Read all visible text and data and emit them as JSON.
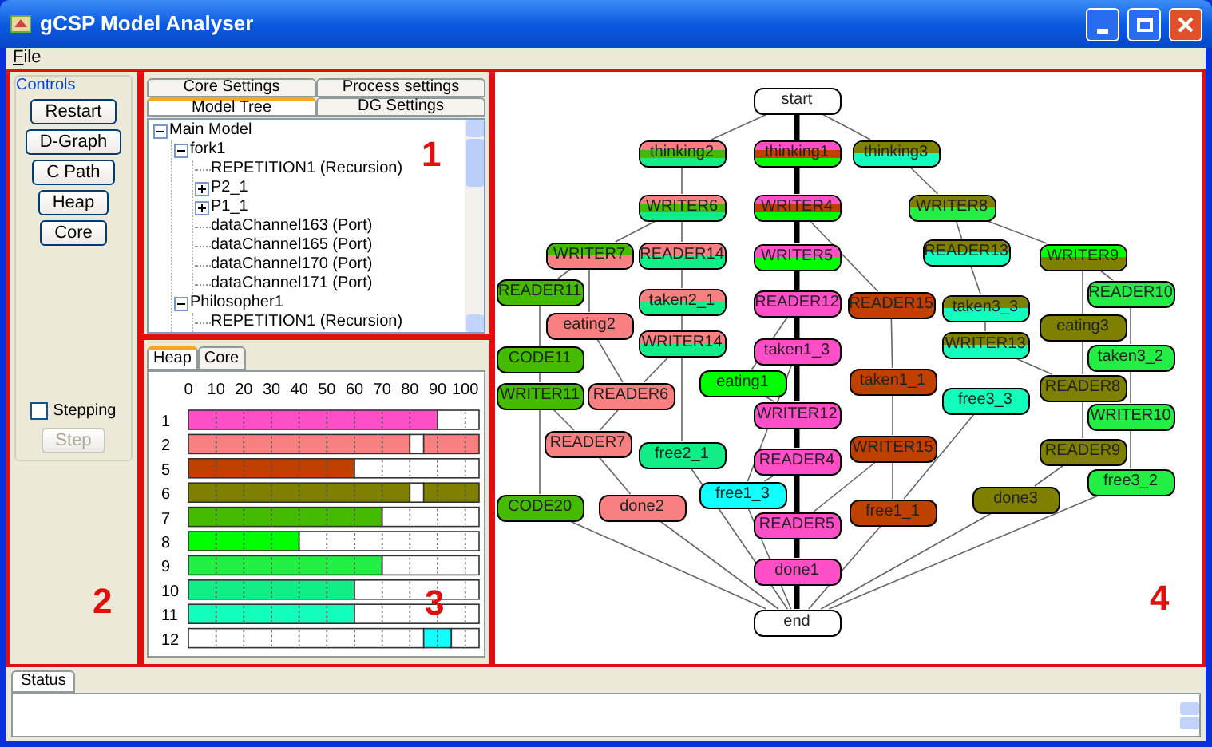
{
  "window": {
    "title": "gCSP Model Analyser"
  },
  "menu": [
    "File"
  ],
  "controls": {
    "title": "Controls",
    "buttons": [
      {
        "label": "Restart"
      },
      {
        "label": "D-Graph"
      },
      {
        "label": "C Path"
      },
      {
        "label": "Heap"
      },
      {
        "label": "Core"
      }
    ],
    "stepping": {
      "label": "Stepping",
      "checked": false
    },
    "step_button": {
      "label": "Step",
      "disabled": true
    }
  },
  "settings_panel": {
    "tab_rows": [
      [
        {
          "label": "Core Settings",
          "selected": false
        },
        {
          "label": "Process settings",
          "selected": false
        }
      ],
      [
        {
          "label": "Model Tree",
          "selected": true
        },
        {
          "label": "DG Settings",
          "selected": false
        }
      ]
    ],
    "tree": [
      {
        "label": "Main Model",
        "expanded": true,
        "children": [
          {
            "label": "fork1",
            "expanded": true,
            "children": [
              {
                "label": "REPETITION1 (Recursion)"
              },
              {
                "label": "P2_1",
                "expanded": false
              },
              {
                "label": "P1_1",
                "expanded": false
              },
              {
                "label": "dataChannel163 (Port)"
              },
              {
                "label": "dataChannel165 (Port)"
              },
              {
                "label": "dataChannel170 (Port)"
              },
              {
                "label": "dataChannel171 (Port)"
              }
            ]
          },
          {
            "label": "Philosopher1",
            "expanded": true,
            "children": [
              {
                "label": "REPETITION1 (Recursion)"
              }
            ]
          }
        ]
      }
    ]
  },
  "usage_panel": {
    "tabs": [
      {
        "label": "Heap",
        "selected": true
      },
      {
        "label": "Core",
        "selected": false
      }
    ],
    "chart_data": {
      "type": "bar",
      "orientation": "horizontal",
      "stacked": true,
      "categories": [
        "1",
        "2",
        "5",
        "6",
        "7",
        "8",
        "9",
        "10",
        "11",
        "12"
      ],
      "xlim": [
        0,
        105
      ],
      "xticks": [
        0,
        10,
        20,
        30,
        40,
        50,
        60,
        70,
        80,
        90,
        100
      ],
      "series": [
        {
          "colors": [
            "#ff4fc8",
            "#f88080",
            "#c04000",
            "#808000",
            "#44bb00",
            "#00ff00",
            "#22ee44",
            "#11ee88",
            "#11ffbb",
            null
          ],
          "values": [
            90,
            80,
            60,
            80,
            70,
            40,
            70,
            60,
            60,
            null
          ]
        },
        {
          "color": "#ffffff",
          "values": [
            null,
            5,
            null,
            5,
            null,
            null,
            null,
            null,
            null,
            85
          ]
        },
        {
          "colors": [
            null,
            "#f88080",
            null,
            "#808000",
            null,
            null,
            null,
            null,
            null,
            "#11ffff"
          ],
          "values": [
            null,
            20,
            null,
            20,
            null,
            null,
            null,
            null,
            null,
            10
          ]
        },
        {
          "color": "#ffffff",
          "values": [
            15,
            null,
            45,
            null,
            35,
            65,
            35,
            45,
            45,
            10
          ]
        }
      ]
    }
  },
  "graph": {
    "nodes": [
      {
        "label": "start",
        "bands": [
          {
            "color": "#ffffff"
          }
        ]
      },
      {
        "label": "thinking2",
        "bands": [
          {
            "color": "#f88080"
          },
          {
            "color": "#44bb00"
          },
          {
            "color": "#11ee88"
          }
        ]
      },
      {
        "label": "thinking1",
        "bands": [
          {
            "color": "#ff4fc8"
          },
          {
            "color": "#c04000"
          },
          {
            "color": "#00ff00"
          }
        ]
      },
      {
        "label": "thinking3",
        "bands": [
          {
            "color": "#808000"
          },
          {
            "color": "#11ffbb"
          }
        ]
      },
      {
        "label": "WRITER6",
        "bands": [
          {
            "color": "#f88080"
          },
          {
            "color": "#44bb00"
          },
          {
            "color": "#11ee88"
          }
        ]
      },
      {
        "label": "WRITER4",
        "bands": [
          {
            "color": "#ff4fc8"
          },
          {
            "color": "#c04000"
          },
          {
            "color": "#00ff00"
          }
        ]
      },
      {
        "label": "WRITER8",
        "bands": [
          {
            "color": "#808000"
          },
          {
            "color": "#22ee44"
          }
        ]
      },
      {
        "label": "WRITER7",
        "bands": [
          {
            "color": "#44bb00"
          },
          {
            "color": "#f88080"
          }
        ]
      },
      {
        "label": "READER14",
        "bands": [
          {
            "color": "#f88080"
          },
          {
            "color": "#11ee88"
          }
        ]
      },
      {
        "label": "WRITER5",
        "bands": [
          {
            "color": "#ff4fc8"
          },
          {
            "color": "#00ff00"
          }
        ]
      },
      {
        "label": "READER13",
        "bands": [
          {
            "color": "#808000"
          },
          {
            "color": "#11ffbb"
          }
        ]
      },
      {
        "label": "WRITER9",
        "bands": [
          {
            "color": "#00ff00"
          },
          {
            "color": "#808000"
          }
        ]
      },
      {
        "label": "READER11",
        "bands": [
          {
            "color": "#44bb00"
          }
        ]
      },
      {
        "label": "eating2",
        "bands": [
          {
            "color": "#f88080"
          }
        ]
      },
      {
        "label": "taken2_1",
        "bands": [
          {
            "color": "#f88080"
          },
          {
            "color": "#11ee88"
          }
        ]
      },
      {
        "label": "READER12",
        "bands": [
          {
            "color": "#ff4fc8"
          }
        ]
      },
      {
        "label": "READER15",
        "bands": [
          {
            "color": "#c04000"
          }
        ]
      },
      {
        "label": "taken3_3",
        "bands": [
          {
            "color": "#808000"
          },
          {
            "color": "#11ffbb"
          }
        ]
      },
      {
        "label": "READER10",
        "bands": [
          {
            "color": "#22ee44"
          }
        ]
      },
      {
        "label": "eating3",
        "bands": [
          {
            "color": "#808000"
          }
        ]
      },
      {
        "label": "CODE11",
        "bands": [
          {
            "color": "#44bb00"
          }
        ]
      },
      {
        "label": "WRITER14",
        "bands": [
          {
            "color": "#f88080"
          },
          {
            "color": "#11ee88"
          }
        ]
      },
      {
        "label": "taken1_3",
        "bands": [
          {
            "color": "#ff4fc8"
          }
        ]
      },
      {
        "label": "WRITER13",
        "bands": [
          {
            "color": "#808000"
          },
          {
            "color": "#11ffbb"
          }
        ]
      },
      {
        "label": "taken3_2",
        "bands": [
          {
            "color": "#22ee44"
          }
        ]
      },
      {
        "label": "WRITER11",
        "bands": [
          {
            "color": "#44bb00"
          }
        ]
      },
      {
        "label": "READER6",
        "bands": [
          {
            "color": "#f88080"
          }
        ]
      },
      {
        "label": "eating1",
        "bands": [
          {
            "color": "#00ff00"
          }
        ]
      },
      {
        "label": "taken1_1",
        "bands": [
          {
            "color": "#c04000"
          }
        ]
      },
      {
        "label": "free3_3",
        "bands": [
          {
            "color": "#11ffbb"
          }
        ]
      },
      {
        "label": "READER8",
        "bands": [
          {
            "color": "#808000"
          }
        ]
      },
      {
        "label": "WRITER12",
        "bands": [
          {
            "color": "#ff4fc8"
          }
        ]
      },
      {
        "label": "WRITER10",
        "bands": [
          {
            "color": "#22ee44"
          }
        ]
      },
      {
        "label": "READER7",
        "bands": [
          {
            "color": "#f88080"
          }
        ]
      },
      {
        "label": "free2_1",
        "bands": [
          {
            "color": "#11ee88"
          }
        ]
      },
      {
        "label": "READER4",
        "bands": [
          {
            "color": "#ff4fc8"
          }
        ]
      },
      {
        "label": "WRITER15",
        "bands": [
          {
            "color": "#c04000"
          }
        ]
      },
      {
        "label": "READER9",
        "bands": [
          {
            "color": "#808000"
          }
        ]
      },
      {
        "label": "free3_2",
        "bands": [
          {
            "color": "#22ee44"
          }
        ]
      },
      {
        "label": "CODE20",
        "bands": [
          {
            "color": "#44bb00"
          }
        ]
      },
      {
        "label": "done2",
        "bands": [
          {
            "color": "#f88080"
          }
        ]
      },
      {
        "label": "free1_3",
        "bands": [
          {
            "color": "#11ffff"
          }
        ]
      },
      {
        "label": "READER5",
        "bands": [
          {
            "color": "#ff4fc8"
          }
        ]
      },
      {
        "label": "free1_1",
        "bands": [
          {
            "color": "#c04000"
          }
        ]
      },
      {
        "label": "done3",
        "bands": [
          {
            "color": "#808000"
          }
        ]
      },
      {
        "label": "done1",
        "bands": [
          {
            "color": "#ff4fc8"
          }
        ]
      },
      {
        "label": "end",
        "bands": [
          {
            "color": "#ffffff"
          }
        ]
      }
    ]
  },
  "annotations": [
    "1",
    "2",
    "3",
    "4"
  ],
  "status": {
    "tabs": [
      {
        "label": "Status",
        "selected": true
      }
    ]
  }
}
